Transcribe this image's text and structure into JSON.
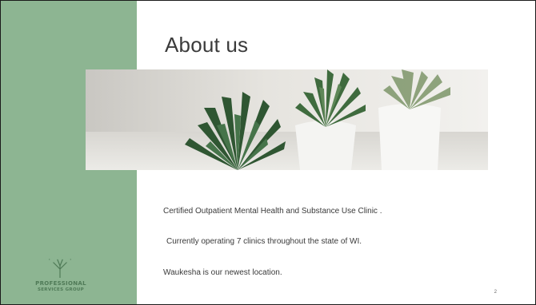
{
  "slide": {
    "title": "About us",
    "lines": [
      "Certified Outpatient Mental Health and Substance Use Clinic .",
      "Currently operating 7 clinics throughout the state of WI.",
      "Waukesha is our newest location."
    ],
    "page_number": "2",
    "logo": {
      "line1": "PROFESSIONAL",
      "line2": "SERVICES GROUP"
    }
  },
  "colors": {
    "sidebar": "#8db592",
    "logo_green": "#4f7a57",
    "title": "#3b3b3b"
  },
  "icons": {
    "photo": "succulent-plants-photo",
    "logo": "tree-logo-icon"
  }
}
